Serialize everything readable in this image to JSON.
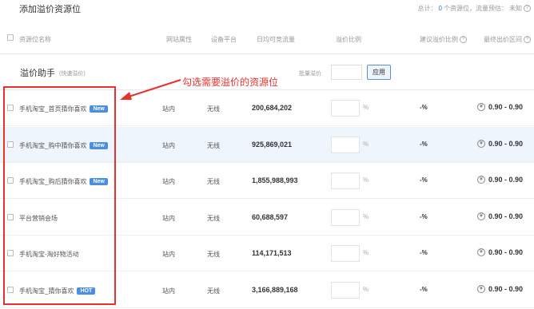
{
  "header": {
    "title": "添加溢价资源位",
    "summary_prefix": "总计：",
    "selected_count": "0",
    "summary_mid": "个资源位，流量预估：",
    "traffic_estimate": "未知"
  },
  "columns": {
    "name": "资源位名称",
    "site_attr": "网站属性",
    "platform": "设备平台",
    "daily_traffic": "日均可竞流量",
    "premium_ratio": "溢价比例",
    "suggested_ratio": "建议溢价比例",
    "final_price": "最终出价区间"
  },
  "helper": {
    "title": "溢价助手",
    "subtitle": "(快速溢价)",
    "batch_label": "批量溢价",
    "apply_label": "应用"
  },
  "annotation": "勾选需要溢价的资源位",
  "rows": [
    {
      "name": "手机淘宝_首页猜你喜欢",
      "badge": "New",
      "site": "站内",
      "platform": "无线",
      "traffic": "200,684,202",
      "pct": "%",
      "suggested": "-%",
      "price": "0.90 - 0.90"
    },
    {
      "name": "手机淘宝_购中猜你喜欢",
      "badge": "New",
      "site": "站内",
      "platform": "无线",
      "traffic": "925,869,021",
      "pct": "%",
      "suggested": "-%",
      "price": "0.90 - 0.90"
    },
    {
      "name": "手机淘宝_购后猜你喜欢",
      "badge": "New",
      "site": "站内",
      "platform": "无线",
      "traffic": "1,855,988,993",
      "pct": "%",
      "suggested": "-%",
      "price": "0.90 - 0.90"
    },
    {
      "name": "平台营销会场",
      "badge": "",
      "site": "站内",
      "platform": "无线",
      "traffic": "60,688,597",
      "pct": "%",
      "suggested": "-%",
      "price": "0.90 - 0.90"
    },
    {
      "name": "手机淘宝-淘好物活动",
      "badge": "",
      "site": "站内",
      "platform": "无线",
      "traffic": "114,171,513",
      "pct": "%",
      "suggested": "-%",
      "price": "0.90 - 0.90"
    },
    {
      "name": "手机淘宝_猜你喜欢",
      "badge": "HOT",
      "site": "站内",
      "platform": "无线",
      "traffic": "3,166,889,168",
      "pct": "%",
      "suggested": "-%",
      "price": "0.90 - 0.90"
    }
  ],
  "icons": {
    "help": "question-icon",
    "currency": "yen-icon",
    "arrow": "red-arrow"
  },
  "colors": {
    "accent": "#4a8fe2",
    "annotation": "#e8322c",
    "row_alt": "#eef5fc"
  }
}
